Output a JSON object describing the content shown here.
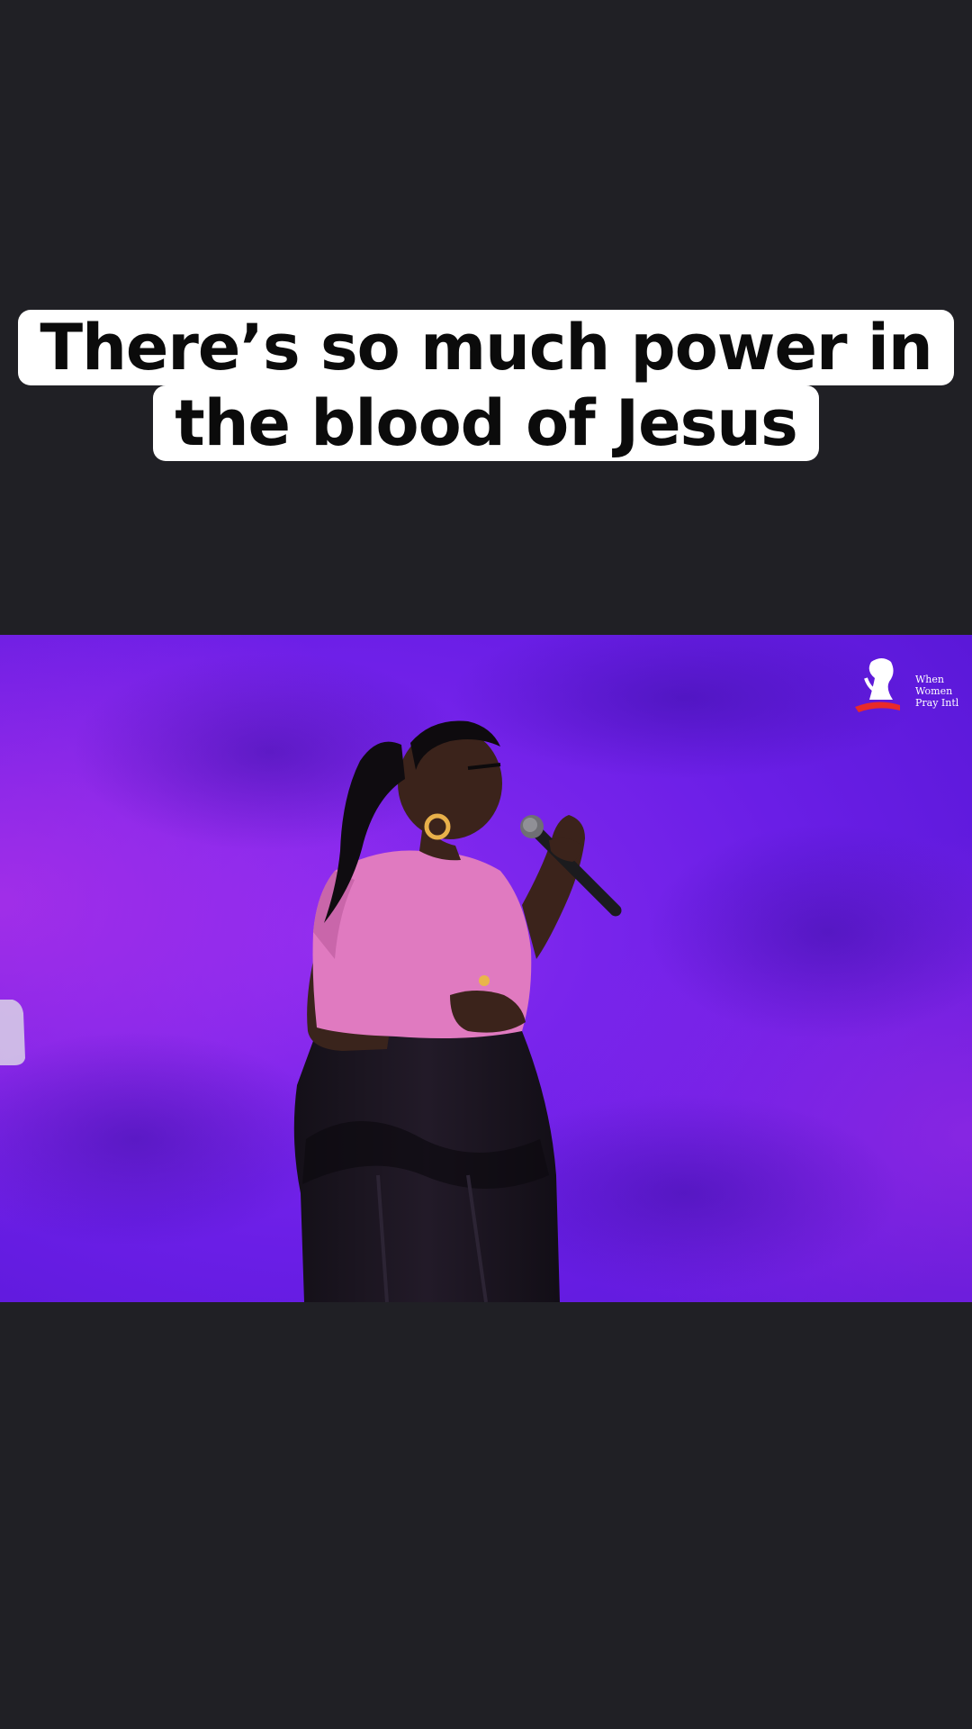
{
  "caption": {
    "line1": "There’s so much power in",
    "line2": "the blood of Jesus"
  },
  "video": {
    "background_color": "#7320e8",
    "subject": "singer-with-microphone",
    "watermark": {
      "icon": "praying-woman-logo-icon",
      "lines": [
        "When",
        "Women",
        "Pray Intl"
      ]
    }
  },
  "colors": {
    "page_background": "#202025",
    "caption_background": "#ffffff",
    "caption_text": "#0b0b0b"
  }
}
